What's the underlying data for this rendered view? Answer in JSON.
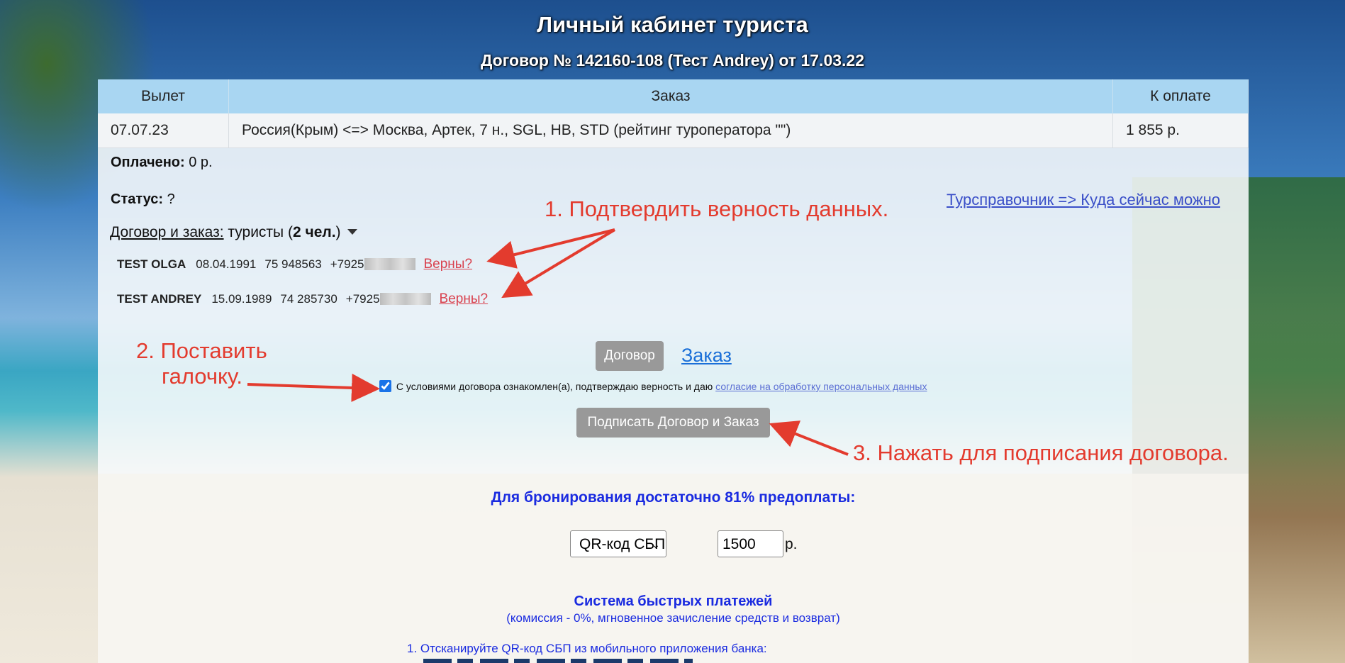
{
  "header": {
    "title": "Личный кабинет туриста",
    "contract": "Договор № 142160-108 (Тест Andrey) от 17.03.22"
  },
  "order_table": {
    "columns": [
      "Вылет",
      "Заказ",
      "К оплате"
    ],
    "row": {
      "departure": "07.07.23",
      "order": "Россия(Крым) <=> Москва, Артек, 7 н., SGL, HB, STD (рейтинг туроператора \"\")",
      "amount": "1 855 р."
    }
  },
  "paid": {
    "label": "Оплачено:",
    "value": "0 р."
  },
  "status": {
    "label": "Статус:",
    "value": "?"
  },
  "guide_link": "Турсправочник => Куда сейчас можно",
  "tourists_header": {
    "link": "Договор и заказ:",
    "text": "туристы (",
    "count": "2 чел.",
    "close": ")"
  },
  "tourists": [
    {
      "name": "TEST OLGA",
      "birth": "08.04.1991",
      "passport": "75 948563",
      "phone": "+7925",
      "confirm": "Верны?"
    },
    {
      "name": "TEST ANDREY",
      "birth": "15.09.1989",
      "passport": "74 285730",
      "phone": "+7925",
      "confirm": "Верны?"
    }
  ],
  "docs": {
    "contract_button": "Договор",
    "order_link": "Заказ"
  },
  "consent": {
    "text": "С условиями договора ознакомлен(а), подтверждаю верность и даю",
    "link": "согласие на обработку персональных данных",
    "checked": true
  },
  "sign_button": "Подписать Договор и Заказ",
  "annotations": {
    "step1": "1. Подтвердить верность данных.",
    "step2_line1": "2. Поставить",
    "step2_line2": "галочку.",
    "step3": "3. Нажать для подписания договора."
  },
  "prepayment": "Для бронирования достаточно 81% предоплаты:",
  "payment": {
    "method": "QR-код СБП",
    "amount": "1500",
    "currency": "р."
  },
  "sbp": {
    "title": "Система быстрых платежей",
    "subtitle": "(комиссия - 0%, мгновенное зачисление средств и возврат)",
    "step1": "1. Отсканируйте QR-код СБП из мобильного приложения банка:"
  },
  "colors": {
    "annotation": "#e33b2e",
    "link": "#3a4fc8",
    "table_header": "#a9d6f2",
    "sbp_text": "#1a2be0"
  }
}
